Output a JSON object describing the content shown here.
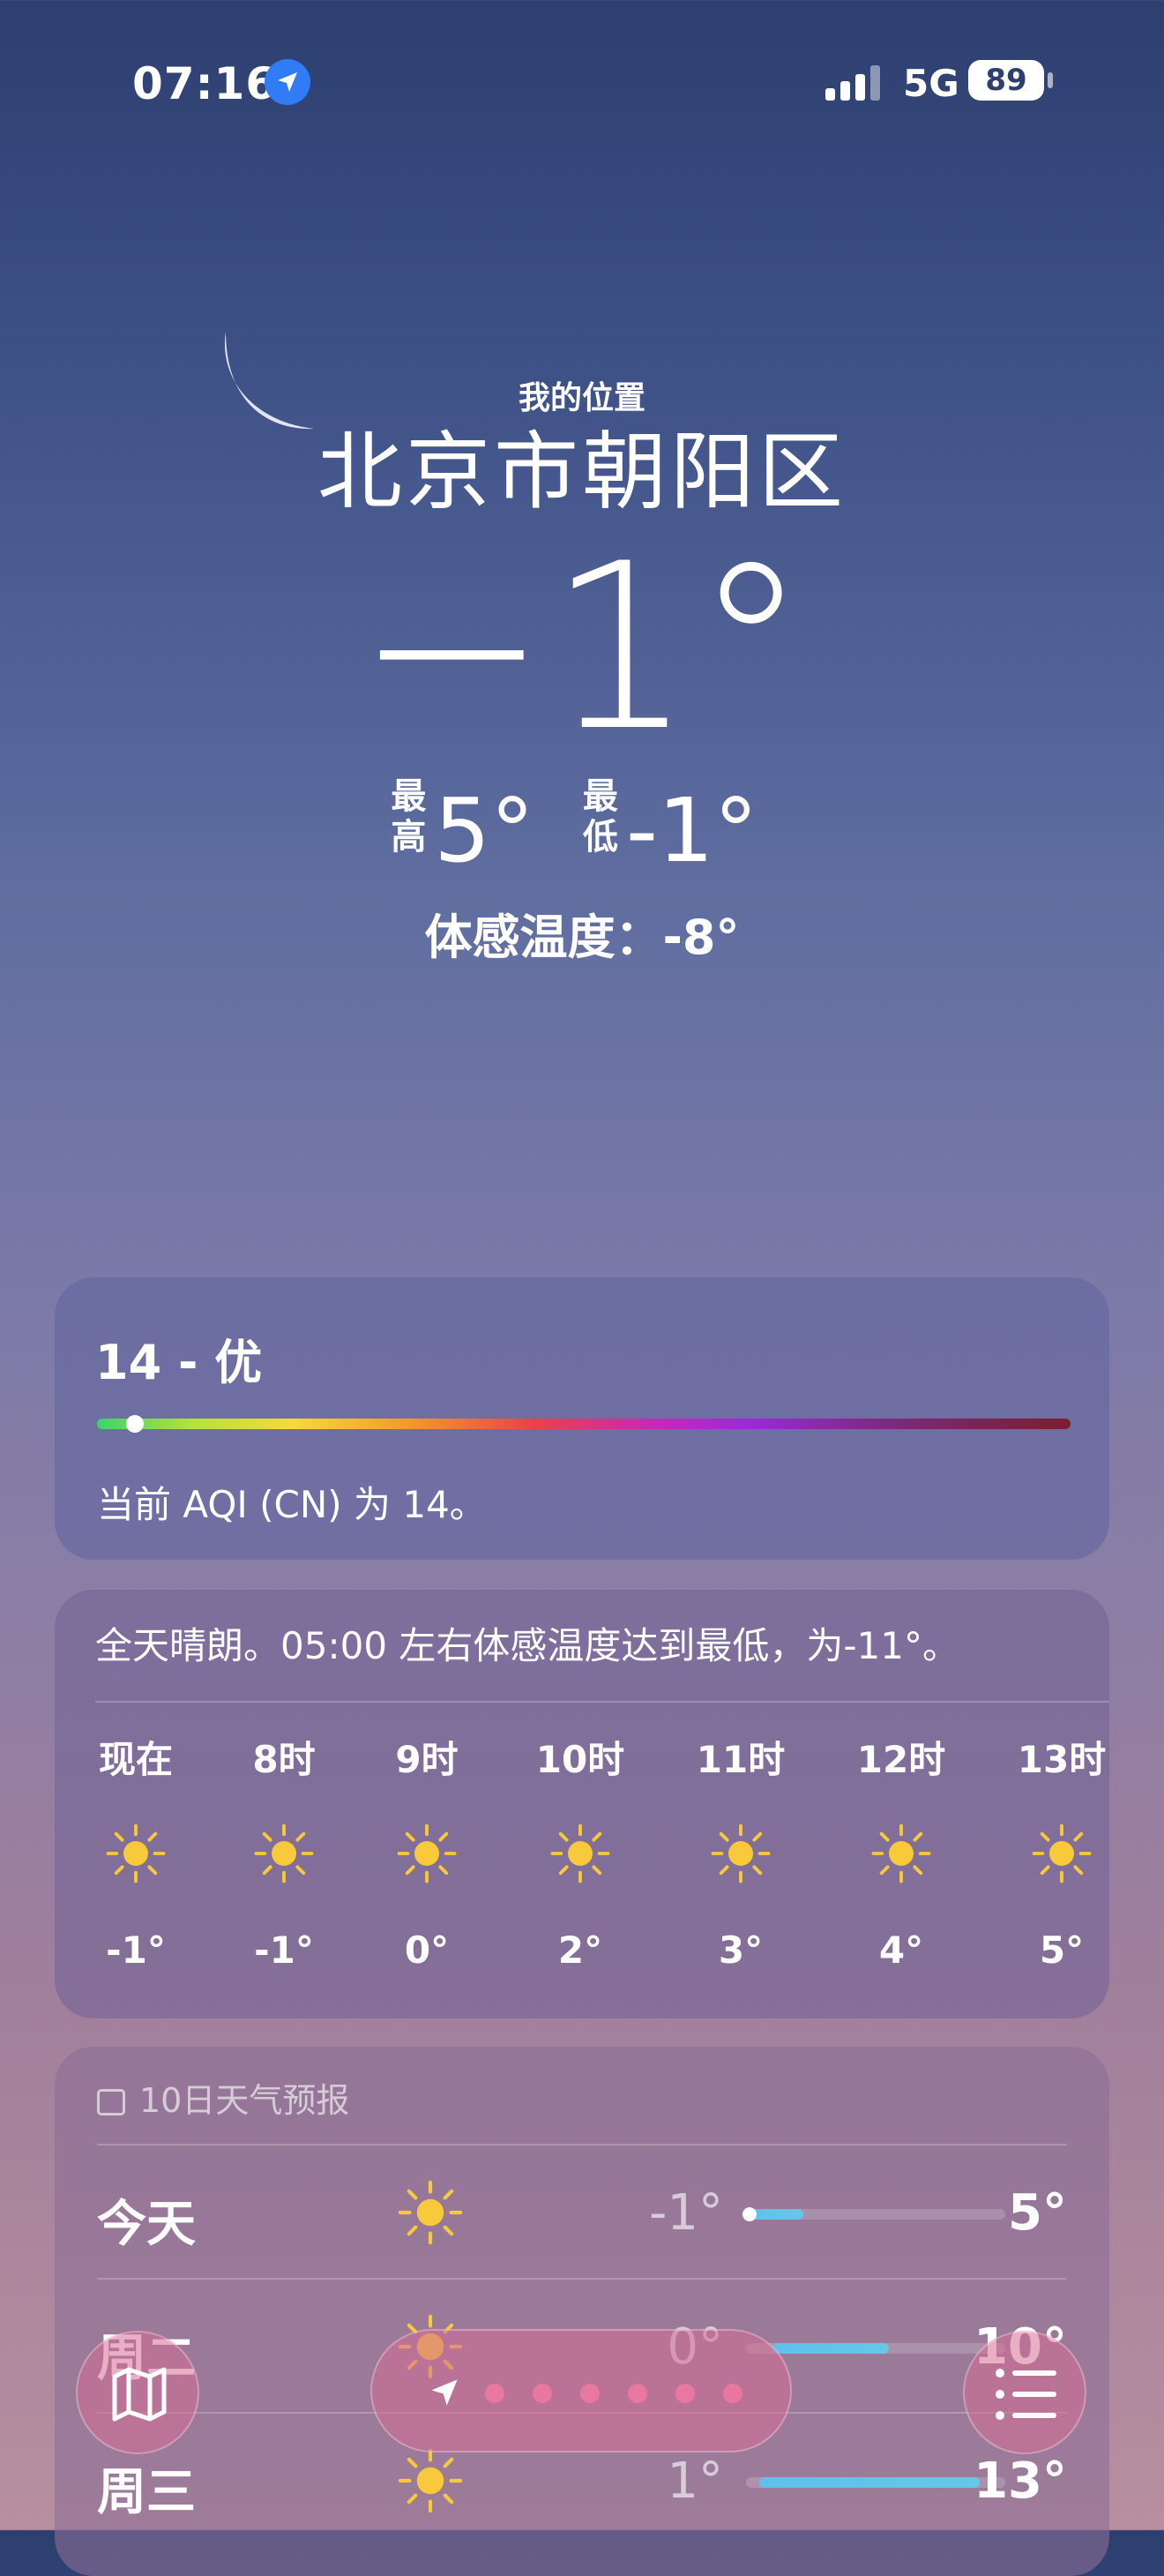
{
  "status_bar": {
    "time": "07:16",
    "network": "5G",
    "battery": "89",
    "signal_bars": 4
  },
  "location": {
    "label": "我的位置",
    "city": "北京市朝阳区",
    "current_temp": "−1°",
    "high_label": "最高",
    "high_value": "5°",
    "low_label": "最低",
    "low_value": "-1°",
    "feels_like": "体感温度：-8°"
  },
  "aqi": {
    "title": "14 - 优",
    "description": "当前 AQI (CN) 为 14。",
    "indicator_fraction": 0.03
  },
  "hourly": {
    "summary": "全天晴朗。05:00 左右体感温度达到最低，为-11°。",
    "items": [
      {
        "hour": "现在",
        "icon": "sun-icon",
        "temp": "-1°"
      },
      {
        "hour": "8时",
        "icon": "sun-icon",
        "temp": "-1°"
      },
      {
        "hour": "9时",
        "icon": "sun-icon",
        "temp": "0°"
      },
      {
        "hour": "10时",
        "icon": "sun-icon",
        "temp": "2°"
      },
      {
        "hour": "11时",
        "icon": "sun-icon",
        "temp": "3°"
      },
      {
        "hour": "12时",
        "icon": "sun-icon",
        "temp": "4°"
      },
      {
        "hour": "13时",
        "icon": "sun-icon",
        "temp": "5°"
      }
    ]
  },
  "ten_day": {
    "title": "10日天气预报",
    "days": [
      {
        "day": "今天",
        "icon": "sun-icon",
        "low": "-1°",
        "high": "5°",
        "range_start": 0.0,
        "range_end": 0.22,
        "current": 0.0
      },
      {
        "day": "周二",
        "icon": "sun-icon",
        "low": "0°",
        "high": "10°",
        "range_start": 0.1,
        "range_end": 0.55
      },
      {
        "day": "周三",
        "icon": "sun-icon",
        "low": "1°",
        "high": "13°",
        "range_start": 0.05,
        "range_end": 0.9
      }
    ]
  },
  "bottom_bar": {
    "page_count": 6,
    "active_page": "current-location"
  },
  "colors": {
    "sun": "#f8c93a",
    "temp_bar": "#5fc0ee",
    "location_badge": "#2f7cf6"
  }
}
